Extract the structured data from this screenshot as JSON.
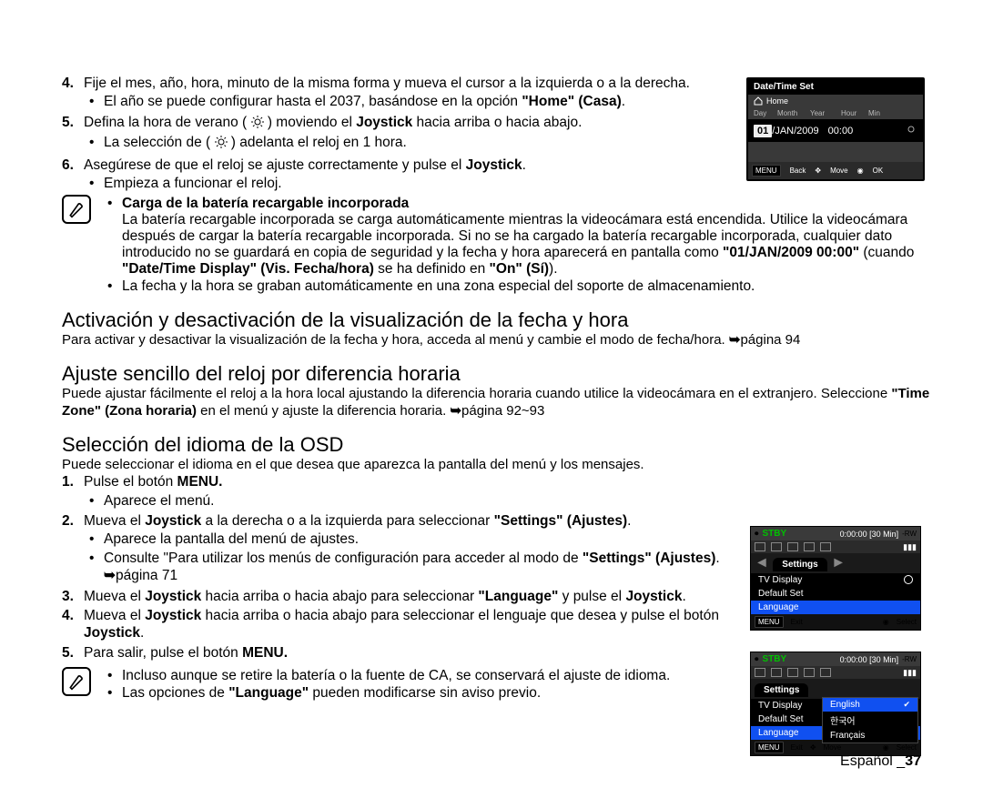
{
  "step4": {
    "num": "4.",
    "text_a": "Fije el mes, año, hora, minuto de la misma forma y mueva el cursor a la izquierda o a la derecha.",
    "bullet": "El año se puede configurar hasta el 2037, basándose en la opción ",
    "bold": "\"Home\" (Casa)",
    "tail": "."
  },
  "step5": {
    "num": "5.",
    "a": "Defina la hora de verano ( ",
    "b": " ) moviendo el ",
    "joy": "Joystick",
    "c": " hacia arriba o hacia abajo.",
    "bullet": "La selección de ( ",
    "bullet2": " ) adelanta el reloj en 1 hora."
  },
  "step6": {
    "num": "6.",
    "a": "Asegúrese de que el reloj se ajuste correctamente y pulse el ",
    "joy": "Joystick",
    "b": ".",
    "bullet": "Empieza a funcionar el reloj."
  },
  "note1": {
    "h": "Carga de la batería recargable incorporada",
    "l1": "La batería recargable incorporada se carga automáticamente mientras la videocámara está encendida. Utilice la videocámara después de cargar la batería recargable incorporada. Si no se ha cargado la batería recargable incorporada, cualquier dato introducido no se guardará en copia de seguridad y la fecha y hora aparecerá en pantalla como ",
    "s1": "\"01/JAN/2009 00:00\"",
    "m1": " (cuando ",
    "s2": "\"Date/Time Display\" (Vis. Fecha/hora)",
    "m2": " se ha definido en ",
    "s3": "\"On\" (Sí)",
    "m3": ").",
    "l2": "La fecha y la hora se graban automáticamente en una zona especial del soporte de almacenamiento."
  },
  "h1": "Activación y desactivación de la visualización de la fecha y hora",
  "p1a": "Para activar y desactivar la visualización de la fecha y hora, acceda al menú y cambie el modo de fecha/hora. ",
  "p1b": "página 94",
  "h2": "Ajuste sencillo del reloj por diferencia horaria",
  "p2a": "Puede ajustar fácilmente el reloj a la hora local ajustando la diferencia horaria cuando utilice la videocámara en el extranjero. Seleccione ",
  "p2b": "\"Time Zone\" (Zona horaria)",
  "p2c": " en el menú y ajuste la diferencia horaria. ",
  "p2d": "página 92~93",
  "h3": "Selección del idioma de la OSD",
  "p3": "Puede seleccionar el idioma en el que desea que aparezca la pantalla del menú y los mensajes.",
  "steps2": {
    "1": {
      "n": "1.",
      "a": "Pulse el botón ",
      "b": "MENU.",
      "bl": "Aparece el menú."
    },
    "2": {
      "n": "2.",
      "a": "Mueva el ",
      "j": "Joystick",
      "b": " a la derecha o a la izquierda para seleccionar ",
      "s": "\"Settings\" (Ajustes)",
      "t": ".",
      "bl1": "Aparece la pantalla del menú de ajustes.",
      "bl2a": "Consulte \"Para utilizar los menús de configuración para acceder al modo de ",
      "bl2b": "\"Settings\" (Ajustes)",
      "bl2c": ". ",
      "bl2d": "página 71"
    },
    "3": {
      "n": "3.",
      "a": "Mueva el ",
      "j": "Joystick",
      "b": " hacia arriba o hacia abajo para seleccionar ",
      "s": "\"Language\"",
      "c": " y pulse el ",
      "j2": "Joystick",
      "t": "."
    },
    "4": {
      "n": "4.",
      "a": "Mueva el ",
      "j": "Joystick",
      "b": " hacia arriba o hacia abajo para seleccionar el lenguaje que desea y pulse el botón ",
      "j2": "Joystick",
      "t": "."
    },
    "5": {
      "n": "5.",
      "a": "Para salir, pulse el botón ",
      "b": "MENU."
    }
  },
  "note2": {
    "l1": "Incluso aunque se retire la batería o la fuente de CA, se conservará el ajuste de idioma.",
    "l2a": "Las opciones de ",
    "l2b": "\"Language\"",
    "l2c": " pueden modificarse sin aviso previo."
  },
  "footer": {
    "lang": "Español _",
    "page": "37"
  },
  "osd1": {
    "title": "Date/Time Set",
    "home": "Home",
    "cols": {
      "day": "Day",
      "month": "Month",
      "year": "Year",
      "hour": "Hour",
      "min": "Min"
    },
    "day": "01",
    "sep1": " / ",
    "month": "JAN",
    "sep2": " /",
    "year": "2009",
    "hour": "00",
    "sep3": " : ",
    "min": "00",
    "back": "Back",
    "move": "Move",
    "ok": "OK",
    "menu": "MENU"
  },
  "osd2a": {
    "stby": "STBY",
    "counter": "0:00:00 [30 Min]",
    "tab": "Settings",
    "rows": [
      "TV Display",
      "Default Set",
      "Language"
    ],
    "exit": "Exit",
    "select": "Select",
    "menu": "MENU"
  },
  "osd2b": {
    "stby": "STBY",
    "counter": "0:00:00 [30 Min]",
    "tab": "Settings",
    "left": [
      "TV Display",
      "Default Set",
      "Language"
    ],
    "right": [
      "English",
      "한국어",
      "Français"
    ],
    "exit": "Exit",
    "move": "Move",
    "select": "Select",
    "menu": "MENU"
  }
}
